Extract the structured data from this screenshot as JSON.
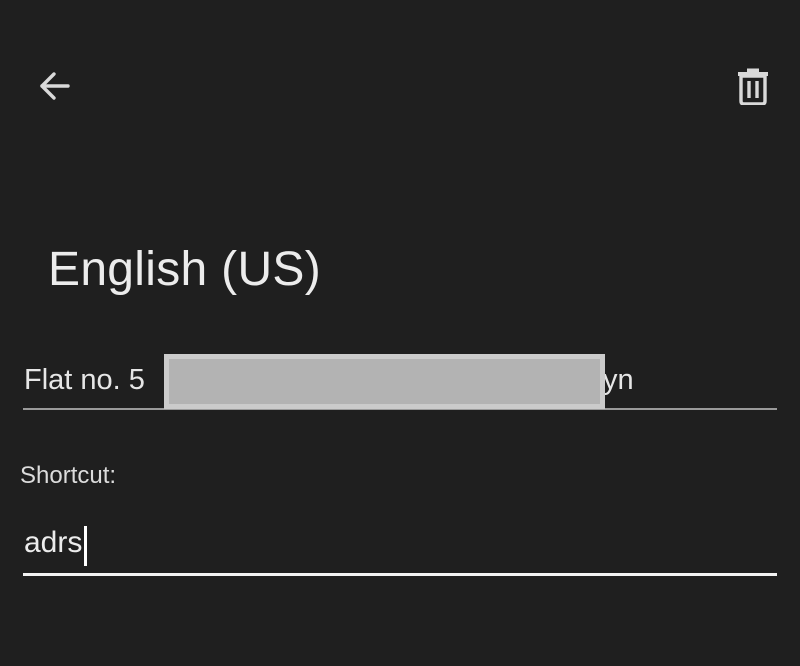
{
  "toolbar": {
    "back_icon": "arrow-left-icon",
    "delete_icon": "trash-icon"
  },
  "page": {
    "title": "English (US)"
  },
  "phrase": {
    "visible_prefix": "Flat no. 5",
    "visible_suffix": "yn"
  },
  "shortcut": {
    "label": "Shortcut:",
    "value": "adrs"
  },
  "colors": {
    "background": "#1f1f1f",
    "text": "#e8e8e8",
    "underline_inactive": "#9a9a9a",
    "underline_active": "#f2f2f2",
    "redaction": "#b3b3b3"
  }
}
